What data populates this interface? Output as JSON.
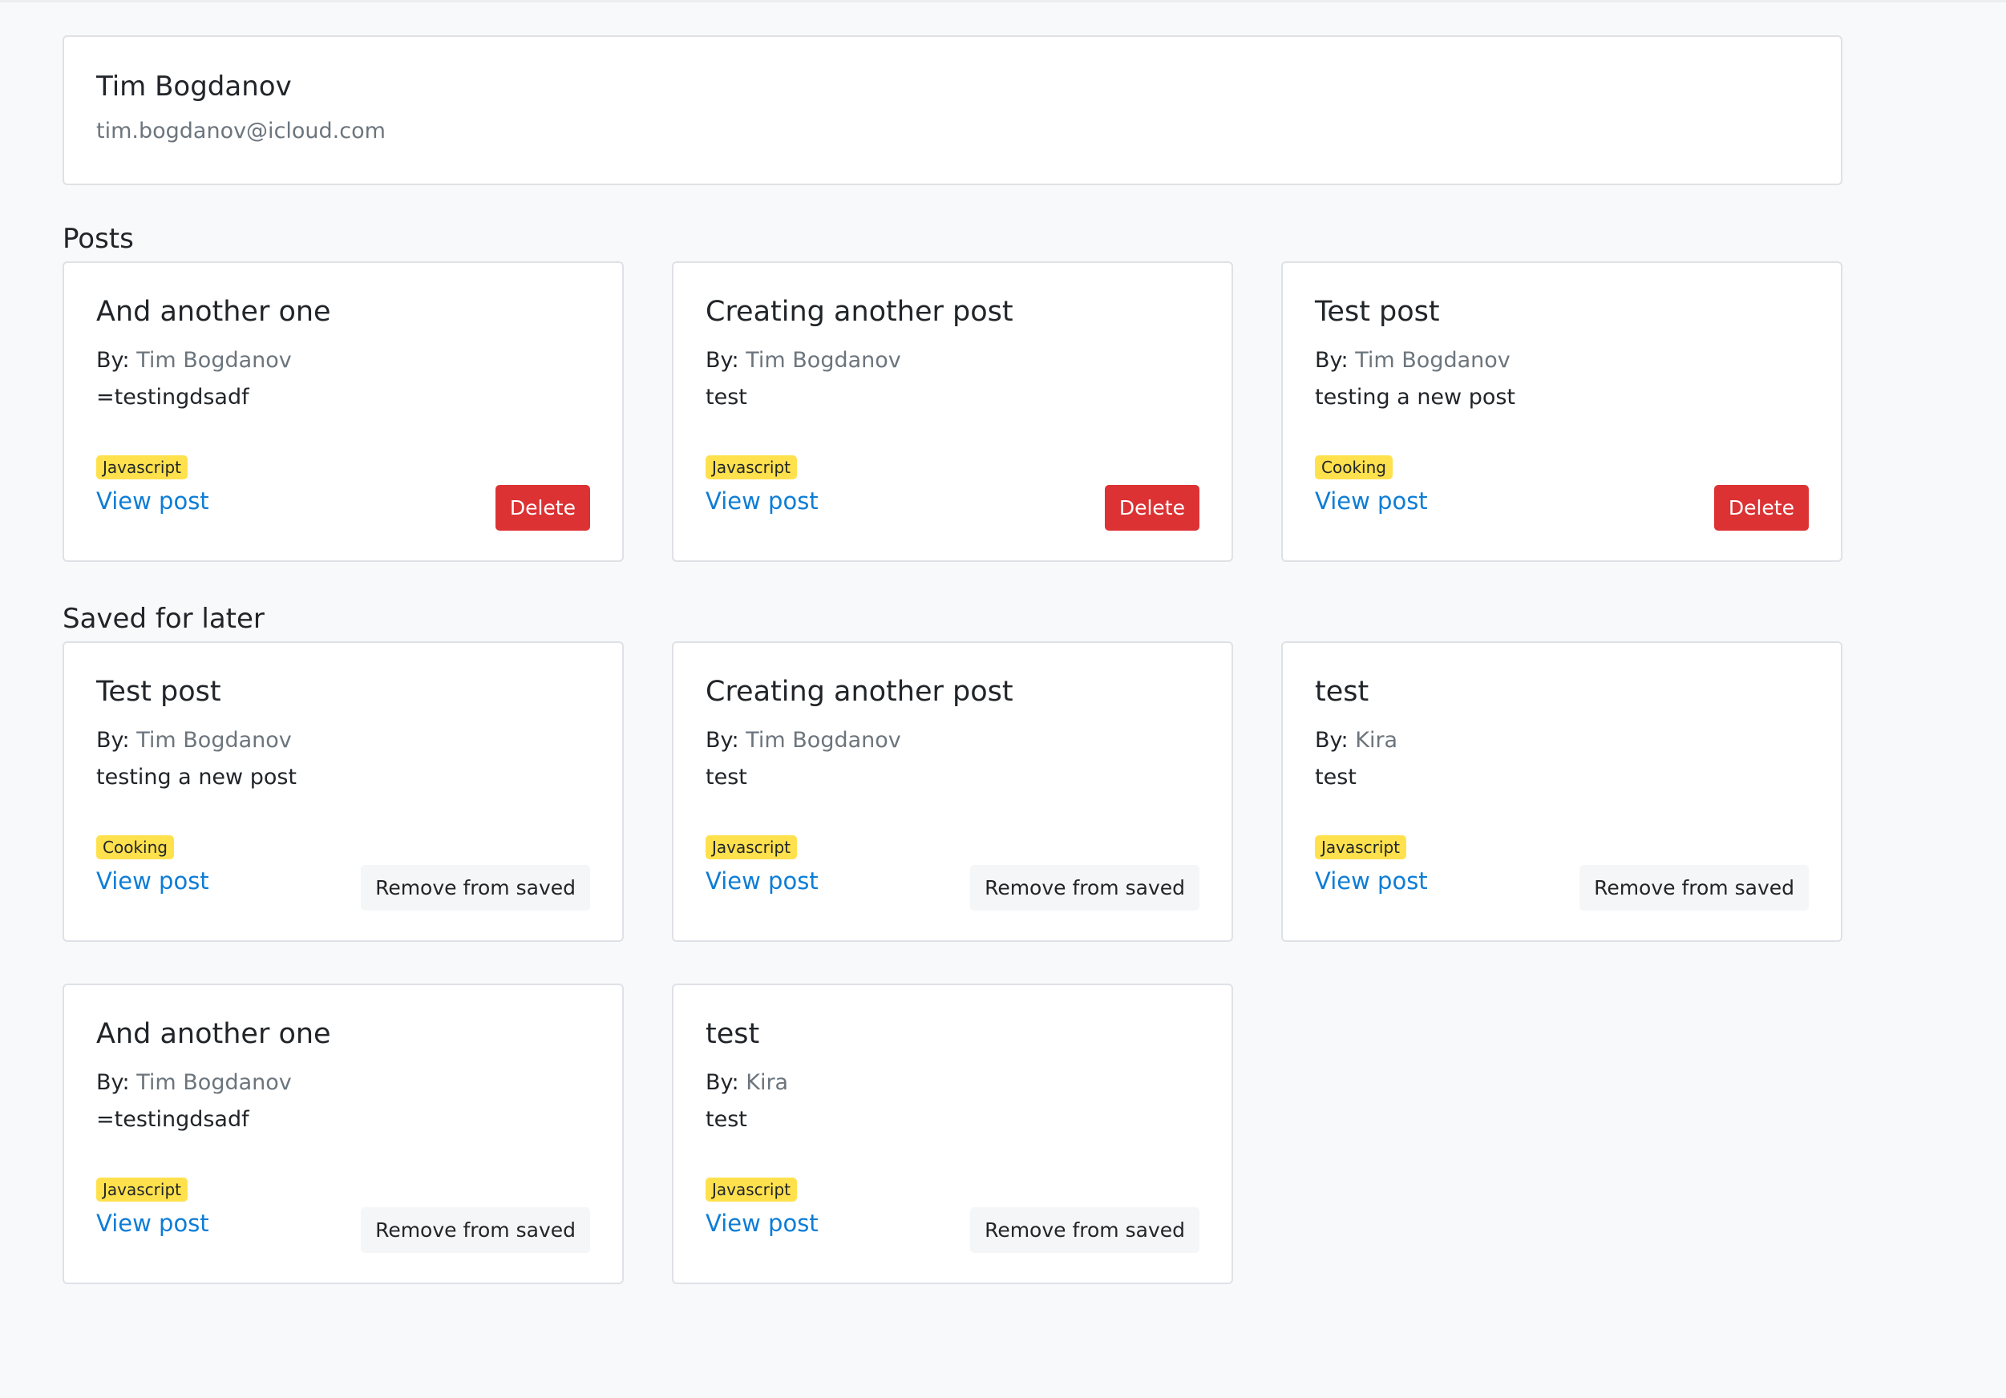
{
  "profile": {
    "name": "Tim Bogdanov",
    "email": "tim.bogdanov@icloud.com"
  },
  "posts": {
    "heading": "Posts",
    "items": [
      {
        "title": "And another one",
        "by_label": "By:",
        "author": "Tim Bogdanov",
        "body": "=testingdsadf",
        "tag": "Javascript",
        "link": "View post",
        "action": "Delete"
      },
      {
        "title": "Creating another post",
        "by_label": "By:",
        "author": "Tim Bogdanov",
        "body": "test",
        "tag": "Javascript",
        "link": "View post",
        "action": "Delete"
      },
      {
        "title": "Test post",
        "by_label": "By:",
        "author": "Tim Bogdanov",
        "body": "testing a new post",
        "tag": "Cooking",
        "link": "View post",
        "action": "Delete"
      }
    ]
  },
  "saved": {
    "heading": "Saved for later",
    "items": [
      {
        "title": "Test post",
        "by_label": "By:",
        "author": "Tim Bogdanov",
        "body": "testing a new post",
        "tag": "Cooking",
        "link": "View post",
        "action": "Remove from saved"
      },
      {
        "title": "Creating another post",
        "by_label": "By:",
        "author": "Tim Bogdanov",
        "body": "test",
        "tag": "Javascript",
        "link": "View post",
        "action": "Remove from saved"
      },
      {
        "title": "test",
        "by_label": "By:",
        "author": "Kira",
        "body": "test",
        "tag": "Javascript",
        "link": "View post",
        "action": "Remove from saved"
      },
      {
        "title": "And another one",
        "by_label": "By:",
        "author": "Tim Bogdanov",
        "body": "=testingdsadf",
        "tag": "Javascript",
        "link": "View post",
        "action": "Remove from saved"
      },
      {
        "title": "test",
        "by_label": "By:",
        "author": "Kira",
        "body": "test",
        "tag": "Javascript",
        "link": "View post",
        "action": "Remove from saved"
      }
    ]
  },
  "colors": {
    "tag_background": "#ffe14d",
    "link": "#0d7dd6",
    "delete_button": "#dc3234",
    "page_background": "#f8f9fa"
  }
}
